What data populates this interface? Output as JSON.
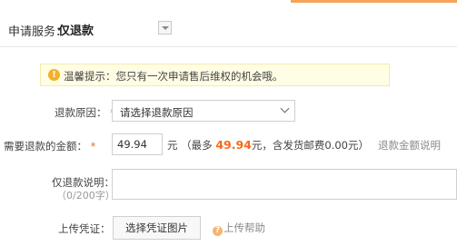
{
  "service": {
    "label": "申请服务：",
    "value": "仅退款",
    "toggle_icon": "triangle-down-icon"
  },
  "tip": {
    "icon": "lightbulb-icon",
    "icon_glyph": "!",
    "text": "温馨提示：您只有一次申请售后维权的机会哦。"
  },
  "reason": {
    "label": "退款原因：",
    "required_mark": "*",
    "selected": "请选择退款原因",
    "chevron_icon": "chevron-down-icon"
  },
  "amount": {
    "label": "需要退款的金额：",
    "required_mark": "*",
    "value": "49.94",
    "unit_prefix": "元 （最多 ",
    "max": "49.94",
    "unit_suffix": "元，含发货邮费0.00元）",
    "help_link": "退款金额说明"
  },
  "description": {
    "label": "仅退款说明：",
    "count": "（0/200字）",
    "value": ""
  },
  "upload": {
    "label": "上传凭证：",
    "button": "选择凭证图片",
    "help_icon_glyph": "?",
    "help": "上传帮助"
  },
  "colors": {
    "accent": "#f56a1a",
    "tip_background": "#fffde4",
    "tip_icon": "#f2b128"
  }
}
